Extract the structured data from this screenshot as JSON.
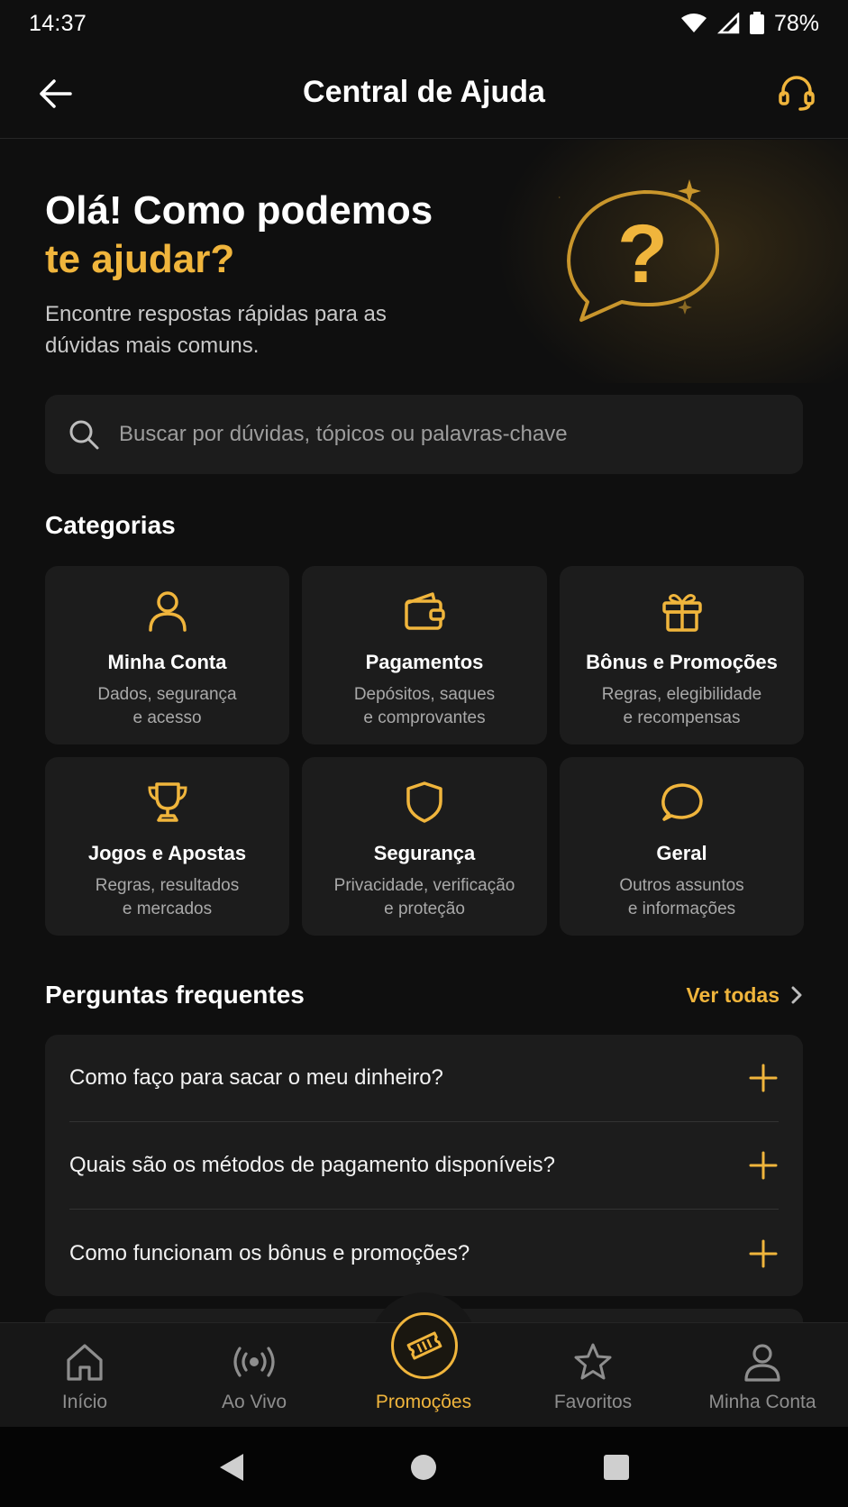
{
  "status": {
    "time": "14:37",
    "battery": "78%"
  },
  "app_bar": {
    "title": "Central de Ajuda"
  },
  "hero": {
    "title_line1": "Olá! Como podemos",
    "title_line2": "te ajudar?",
    "subtitle": "Encontre respostas rápidas para as dúvidas mais comuns."
  },
  "search": {
    "placeholder": "Buscar por dúvidas, tópicos ou palavras-chave"
  },
  "categories": {
    "title": "Categorias",
    "items": [
      {
        "icon": "user-icon",
        "title": "Minha Conta",
        "desc_line1": "Dados, segurança",
        "desc_line2": "e acesso"
      },
      {
        "icon": "wallet-icon",
        "title": "Pagamentos",
        "desc_line1": "Depósitos, saques",
        "desc_line2": "e comprovantes"
      },
      {
        "icon": "gift-icon",
        "title": "Bônus e Promoções",
        "desc_line1": "Regras, elegibilidade",
        "desc_line2": "e recompensas"
      },
      {
        "icon": "trophy-icon",
        "title": "Jogos e Apostas",
        "desc_line1": "Regras, resultados",
        "desc_line2": "e mercados"
      },
      {
        "icon": "shield-icon",
        "title": "Segurança",
        "desc_line1": "Privacidade, verificação",
        "desc_line2": "e proteção"
      },
      {
        "icon": "chat-bubble-icon",
        "title": "Geral",
        "desc_line1": "Outros assuntos",
        "desc_line2": "e informações"
      }
    ]
  },
  "faq": {
    "title": "Perguntas frequentes",
    "see_all": "Ver todas",
    "items": [
      {
        "question": "Como faço para sacar o meu dinheiro?"
      },
      {
        "question": "Quais são os métodos de pagamento disponíveis?"
      },
      {
        "question": "Como funcionam os bônus e promoções?"
      }
    ]
  },
  "bottom_nav": {
    "items": [
      {
        "label": "Início",
        "icon": "home-icon"
      },
      {
        "label": "Ao Vivo",
        "icon": "live-broadcast-icon"
      },
      {
        "label": "Promoções",
        "icon": "ticket-icon",
        "active": true
      },
      {
        "label": "Favoritos",
        "icon": "star-icon"
      },
      {
        "label": "Minha Conta",
        "icon": "user-icon"
      }
    ]
  },
  "colors": {
    "accent": "#f0b53c",
    "background": "#0f0f0f",
    "card": "#1c1c1c",
    "muted_text": "#a9a9a9"
  }
}
